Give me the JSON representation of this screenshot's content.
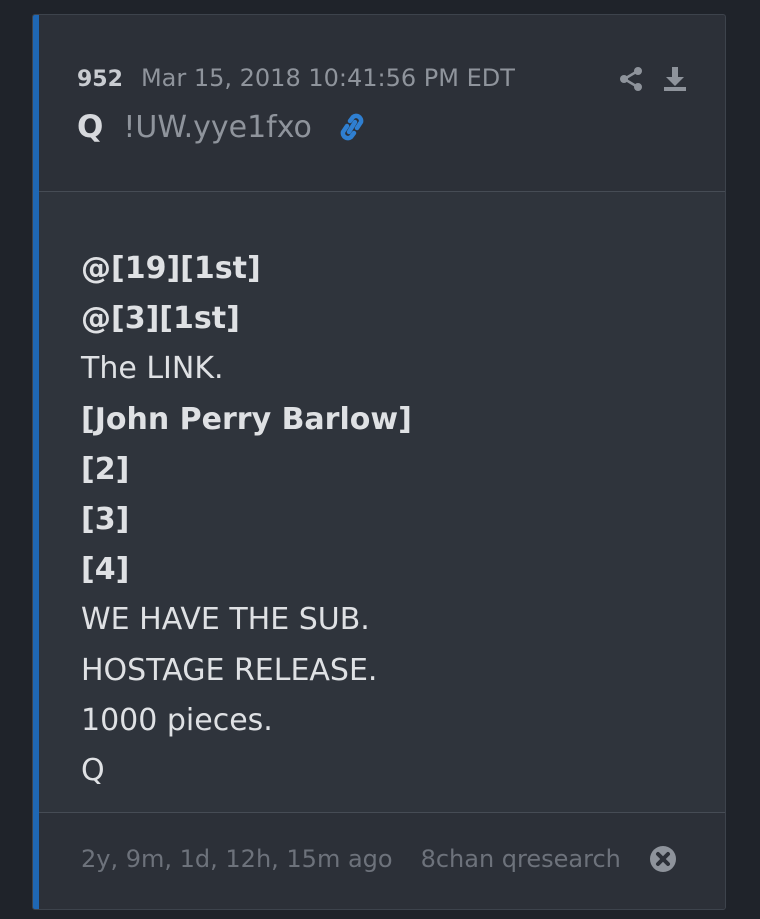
{
  "post": {
    "number": "952",
    "date": "Mar 15, 2018 10:41:56 PM EDT",
    "author": "Q",
    "tripcode": "!UW.yye1fxo",
    "icons": {
      "link": "link-icon",
      "share": "share-icon",
      "download": "download-icon",
      "close": "close-circle-icon"
    },
    "colors": {
      "accent": "#1f67b3",
      "link": "#2f7fd1"
    }
  },
  "message": {
    "lines": [
      "@[19][1st]",
      "@[3][1st]",
      "The LINK.",
      "[John Perry Barlow]",
      "[2]",
      "[3]",
      "[4]",
      "WE HAVE THE SUB.",
      "HOSTAGE RELEASE.",
      "1000 pieces.",
      "Q"
    ]
  },
  "footer": {
    "age": "2y, 9m, 1d, 12h, 15m ago",
    "source": "8chan qresearch"
  }
}
